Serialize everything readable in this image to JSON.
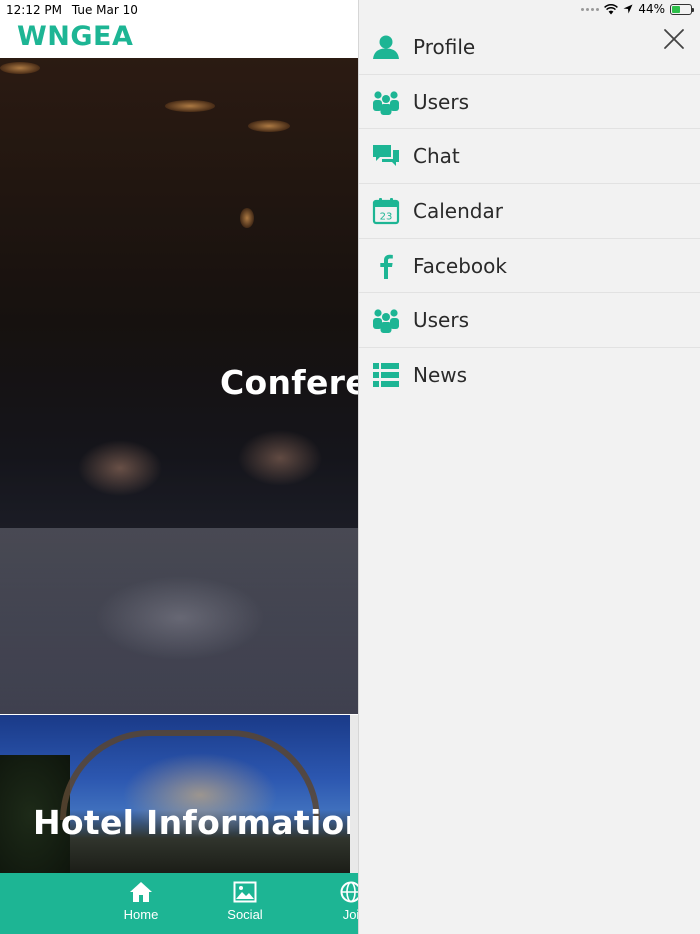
{
  "status_bar": {
    "time": "12:12 PM",
    "date": "Tue Mar 10",
    "battery_percent": "44%",
    "battery_level": 0.44,
    "icons": [
      "signal-dots-icon",
      "wifi-icon",
      "location-arrow-icon",
      "battery-charging-icon"
    ]
  },
  "app": {
    "brand": "WNGEA",
    "brand_color": "#1db594",
    "cards": [
      {
        "title": "Conferen"
      },
      {
        "title": "Hotel Information"
      }
    ],
    "tabs": [
      {
        "label": "Home",
        "icon": "home-icon"
      },
      {
        "label": "Social",
        "icon": "image-icon"
      },
      {
        "label": "Joi",
        "icon": "globe-icon"
      }
    ]
  },
  "drawer": {
    "accent_color": "#1db594",
    "close_icon": "close-icon",
    "items": [
      {
        "label": "Profile",
        "icon": "person-icon"
      },
      {
        "label": "Users",
        "icon": "users-icon"
      },
      {
        "label": "Chat",
        "icon": "chat-icon"
      },
      {
        "label": "Calendar",
        "icon": "calendar-icon",
        "icon_text": "23"
      },
      {
        "label": "Facebook",
        "icon": "facebook-icon"
      },
      {
        "label": "Users",
        "icon": "users-icon"
      },
      {
        "label": "News",
        "icon": "list-icon"
      }
    ]
  }
}
